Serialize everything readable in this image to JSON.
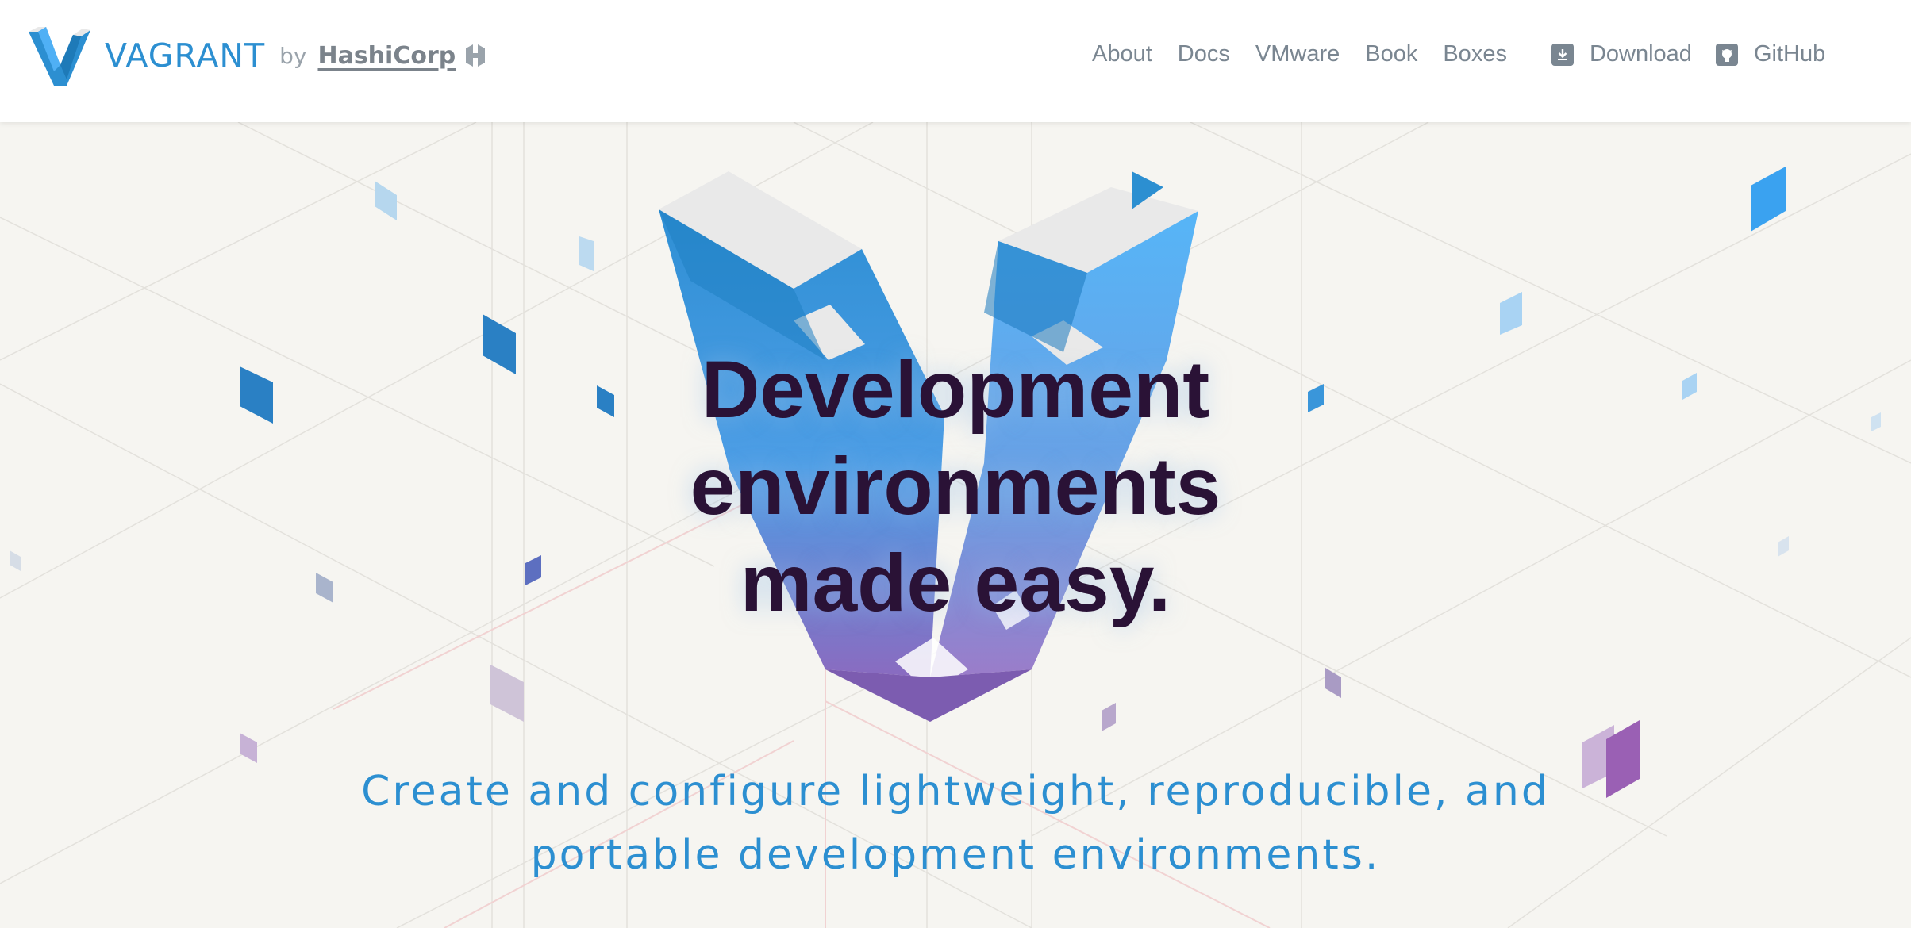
{
  "brand": {
    "name": "VAGRANT",
    "by": "by",
    "company": "HashiCorp"
  },
  "nav": {
    "links": [
      {
        "label": "About"
      },
      {
        "label": "Docs"
      },
      {
        "label": "VMware"
      },
      {
        "label": "Book"
      },
      {
        "label": "Boxes"
      }
    ],
    "download": {
      "label": "Download",
      "icon": "download-icon"
    },
    "github": {
      "label": "GitHub",
      "icon": "github-icon"
    }
  },
  "hero": {
    "title_lines": [
      "Development",
      "environments",
      "made easy."
    ],
    "subtitle_lines": [
      "Create and configure lightweight, reproducible, and",
      "portable development environments."
    ]
  },
  "colors": {
    "accent_blue": "#2c8fd1",
    "title": "#2a1236",
    "nav_text": "#7a8691",
    "background": "#f6f5f1",
    "purple": "#8a5bb8"
  }
}
